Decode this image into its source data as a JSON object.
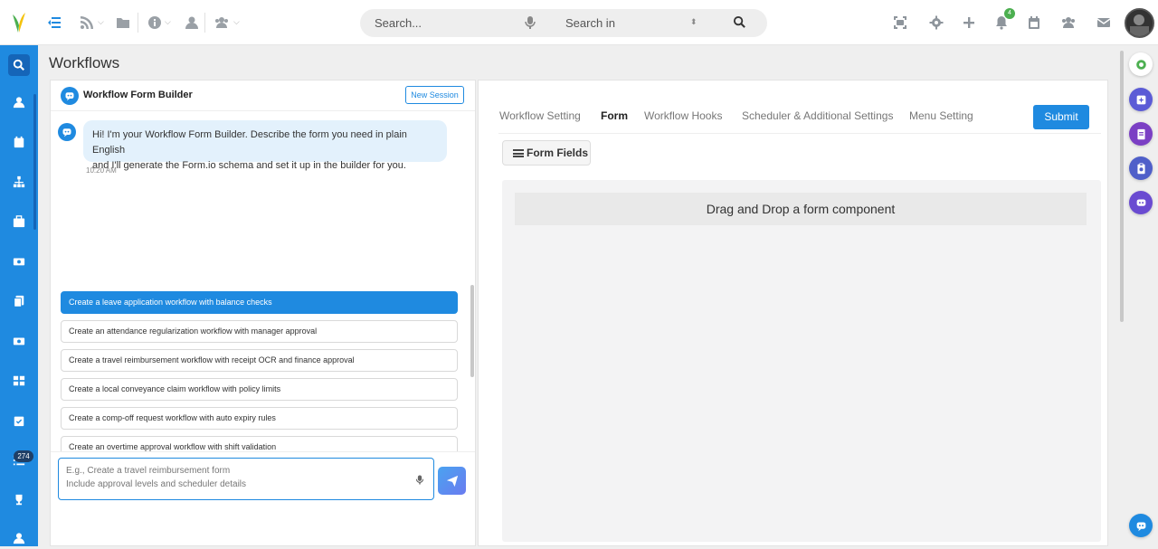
{
  "topbar": {
    "search_placeholder": "Search...",
    "search_in_label": "Search in",
    "notification_count": "4",
    "icons": [
      "menu-toggle-icon",
      "rss-icon",
      "folder-icon",
      "info-icon",
      "user-icon",
      "users-icon",
      "scan-icon",
      "gear-icon",
      "plus-icon",
      "bell-icon",
      "calendar-icon",
      "team-icon",
      "mail-icon"
    ]
  },
  "sidebar": {
    "badge_count": "274",
    "items": [
      "search-icon",
      "user-icon",
      "calendar-icon",
      "org-chart-icon",
      "briefcase-icon",
      "money-icon",
      "documents-icon",
      "cash-icon",
      "dashboard-icon",
      "tasks-icon",
      "list-icon",
      "trophy-icon",
      "profile-icon"
    ]
  },
  "page": {
    "title": "Workflows"
  },
  "chat": {
    "title": "Workflow Form Builder",
    "new_session_label": "New Session",
    "message_line1": "Hi! I'm your Workflow Form Builder. Describe the form you need in plain English",
    "message_line2": "and I'll generate the Form.io schema and set it up in the builder for you.",
    "message_time": "10:20 AM",
    "suggestions": [
      "Create a leave application workflow with balance checks",
      "Create an attendance regularization workflow with manager approval",
      "Create a travel reimbursement workflow with receipt OCR and finance approval",
      "Create a local conveyance claim workflow with policy limits",
      "Create a comp-off request workflow with auto expiry rules",
      "Create an overtime approval workflow with shift validation"
    ],
    "input_placeholder_line1": "E.g., Create a travel reimbursement form",
    "input_placeholder_line2": "Include approval levels and scheduler details"
  },
  "builder": {
    "tabs": [
      "Workflow Setting",
      "Form",
      "Workflow Hooks",
      "Scheduler & Additional Settings",
      "Menu Setting"
    ],
    "active_tab": "Form",
    "submit_label": "Submit",
    "form_fields_label": "Form Fields",
    "dropzone_label": "Drag and Drop a form component"
  },
  "colors": {
    "primary": "#1f8ae0",
    "sidebar": "#1f8ae0",
    "selected_suggestion": "#1f8ae0"
  }
}
